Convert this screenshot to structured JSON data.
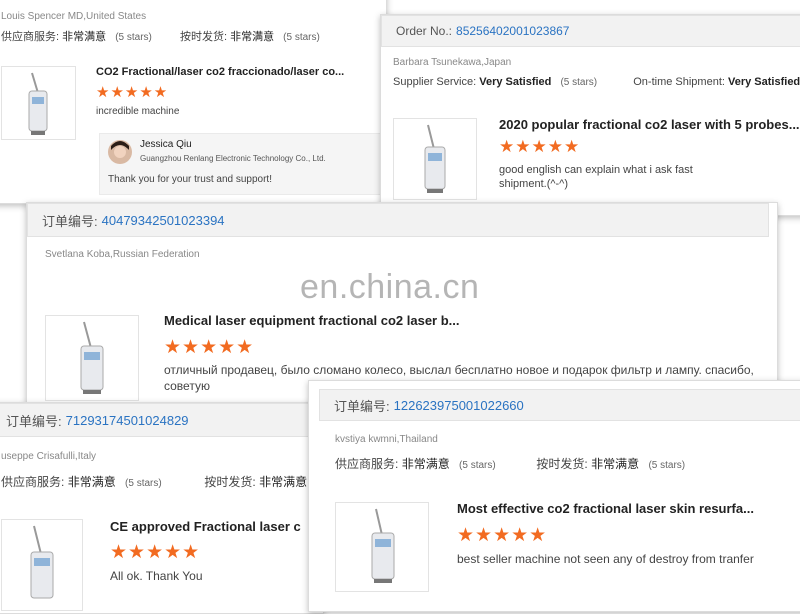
{
  "cards": [
    {
      "id": "card1",
      "buyer": "Louis Spencer MD,United States",
      "supplier_label": "供应商服务:",
      "supplier_value": "非常满意",
      "supplier_stars": "(5 stars)",
      "shipment_label": "按时发货:",
      "shipment_value": "非常满意",
      "shipment_stars": "(5 stars)",
      "title": "CO2 Fractional/laser co2 fraccionado/laser co...",
      "stars": "★★★★★",
      "comment": "incredible machine",
      "reply": {
        "name": "Jessica Qiu",
        "company": "Guangzhou Renlang Electronic Technology Co., Ltd.",
        "text": "Thank you for your trust and support!"
      }
    },
    {
      "id": "card2",
      "order_label": "Order No.:",
      "order_no": "85256402001023867",
      "buyer": "Barbara Tsunekawa,Japan",
      "supplier_label": "Supplier Service:",
      "supplier_value": "Very Satisfied",
      "supplier_stars": "(5 stars)",
      "shipment_label": "On-time Shipment:",
      "shipment_value": "Very Satisfied",
      "title": "2020 popular fractional co2 laser with 5 probes...",
      "stars": "★★★★★",
      "comment": "good english can explain what i ask fast shipment.(^-^)"
    },
    {
      "id": "card3",
      "order_label": "订单编号:",
      "order_no": "40479342501023394",
      "buyer": "Svetlana Koba,Russian Federation",
      "title": "Medical laser equipment fractional co2 laser b...",
      "stars": "★★★★★",
      "comment": "отличный продавец, было сломано колесо, выслал бесплатно новое и подарок фильтр и лампу. спасибо, советую"
    },
    {
      "id": "card4",
      "order_label": "订单编号:",
      "order_no": "71293174501024829",
      "buyer": "useppe Crisafulli,Italy",
      "supplier_label": "供应商服务:",
      "supplier_value": "非常满意",
      "supplier_stars": "(5 stars)",
      "shipment_label": "按时发货:",
      "shipment_value": "非常满意",
      "title": "CE approved Fractional laser c",
      "stars": "★★★★★",
      "comment": "All ok. Thank You"
    },
    {
      "id": "card5",
      "order_label": "订单编号:",
      "order_no": "122623975001022660",
      "buyer": "kvstiya kwmni,Thailand",
      "supplier_label": "供应商服务:",
      "supplier_value": "非常满意",
      "supplier_stars": "(5 stars)",
      "shipment_label": "按时发货:",
      "shipment_value": "非常满意",
      "shipment_stars": "(5 stars)",
      "title": "Most effective co2 fractional laser skin resurfa...",
      "stars": "★★★★★",
      "comment": "best seller machine not seen any of destroy from tranfer"
    }
  ],
  "watermark": "en.china.cn",
  "colors": {
    "star": "#f26b21",
    "order_link": "#2a73c2"
  },
  "icons": [
    "laser-machine-icon",
    "avatar-icon"
  ]
}
